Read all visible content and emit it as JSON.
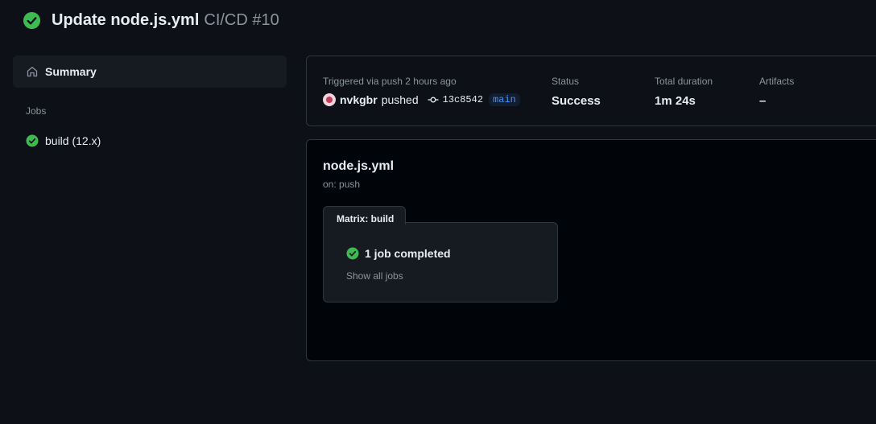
{
  "header": {
    "status_icon": "check-circle-icon",
    "title": "Update node.js.yml",
    "subtitle": "CI/CD #10"
  },
  "sidebar": {
    "summary_label": "Summary",
    "summary_icon": "home-icon",
    "jobs_heading": "Jobs",
    "jobs": [
      {
        "label": "build (12.x)",
        "status": "success",
        "icon": "check-circle-icon"
      }
    ]
  },
  "run_info": {
    "trigger_label": "Triggered via push 2 hours ago",
    "user": "nvkgbr",
    "action": "pushed",
    "commit_sha": "13c8542",
    "branch": "main",
    "status_label": "Status",
    "status_value": "Success",
    "duration_label": "Total duration",
    "duration_value": "1m 24s",
    "artifacts_label": "Artifacts",
    "artifacts_value": "–"
  },
  "workflow": {
    "file_name": "node.js.yml",
    "trigger": "on: push",
    "matrix_label": "Matrix: build",
    "matrix_status": "1 job completed",
    "show_all": "Show all jobs"
  },
  "colors": {
    "background": "#0d1117",
    "panel": "#161b22",
    "border": "#30363d",
    "success": "#3fb950",
    "muted": "#8b949e",
    "accent": "#4493f8"
  }
}
